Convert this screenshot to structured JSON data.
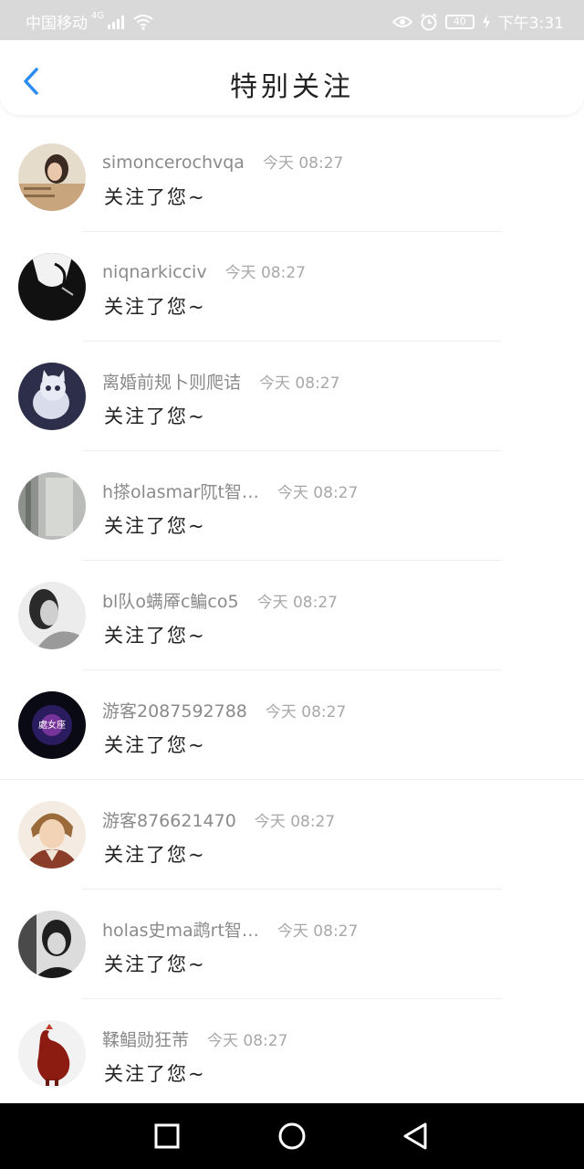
{
  "status_bar": {
    "carrier": "中国移动",
    "network": "4G",
    "battery": "40",
    "time": "下午3:31"
  },
  "header": {
    "title": "特别关注"
  },
  "items": [
    {
      "name": "simoncerochvqa",
      "time": "今天 08:27",
      "message": "关注了您~"
    },
    {
      "name": "niqnarkicciv",
      "time": "今天 08:27",
      "message": "关注了您~"
    },
    {
      "name": "离婚前规卜则爬诘",
      "time": "今天 08:27",
      "message": "关注了您~"
    },
    {
      "name": "h搽olasmar阢t智…",
      "time": "今天 08:27",
      "message": "关注了您~"
    },
    {
      "name": "bl队o螨厣c鳊co5",
      "time": "今天 08:27",
      "message": "关注了您~"
    },
    {
      "name": "游客2087592788",
      "time": "今天 08:27",
      "message": "关注了您~"
    },
    {
      "name": "游客876621470",
      "time": "今天 08:27",
      "message": "关注了您~"
    },
    {
      "name": "holas史ma鹉rt智…",
      "time": "今天 08:27",
      "message": "关注了您~"
    },
    {
      "name": "鞣鲳勋狂芾",
      "time": "今天 08:27",
      "message": "关注了您~"
    }
  ],
  "avatar_badge": "處女座",
  "colors": {
    "accent": "#2a8cf0",
    "status_bar": "#d9d9d9",
    "nav_bar": "#000000"
  }
}
